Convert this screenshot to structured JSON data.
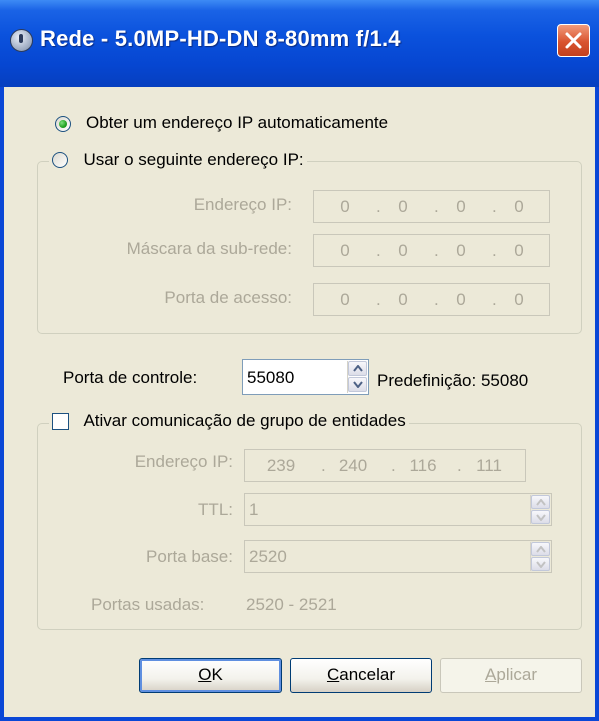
{
  "window": {
    "title": "Rede - 5.0MP-HD-DN 8-80mm f/1.4"
  },
  "ip_mode": {
    "auto_label": "Obter um endereço IP automaticamente",
    "manual_label": "Usar o seguinte endereço IP:",
    "selected": "auto"
  },
  "manual_ip": {
    "ip_label": "Endereço IP:",
    "ip_value": [
      "0",
      "0",
      "0",
      "0"
    ],
    "mask_label": "Máscara da sub-rede:",
    "mask_value": [
      "0",
      "0",
      "0",
      "0"
    ],
    "gateway_label": "Porta de acesso:",
    "gateway_value": [
      "0",
      "0",
      "0",
      "0"
    ]
  },
  "control_port": {
    "label": "Porta de controle:",
    "value": "55080",
    "default_text": "Predefinição: 55080"
  },
  "multicast": {
    "checkbox_label": "Ativar comunicação de grupo de entidades",
    "checked": false,
    "ip_label": "Endereço IP:",
    "ip_value": [
      "239",
      "240",
      "116",
      "111"
    ],
    "ttl_label": "TTL:",
    "ttl_value": "1",
    "base_port_label": "Porta base:",
    "base_port_value": "2520",
    "ports_used_label": "Portas usadas:",
    "ports_used_value": "2520 - 2521"
  },
  "buttons": {
    "ok_mnemonic": "O",
    "ok_rest": "K",
    "cancel_mnemonic": "C",
    "cancel_rest": "ancelar",
    "apply_mnemonic": "A",
    "apply_rest": "plicar"
  },
  "colors": {
    "title_bar": "#0646d1",
    "client_bg": "#ece9d8",
    "close_button": "#d9542f",
    "disabled_text": "#aca899"
  }
}
